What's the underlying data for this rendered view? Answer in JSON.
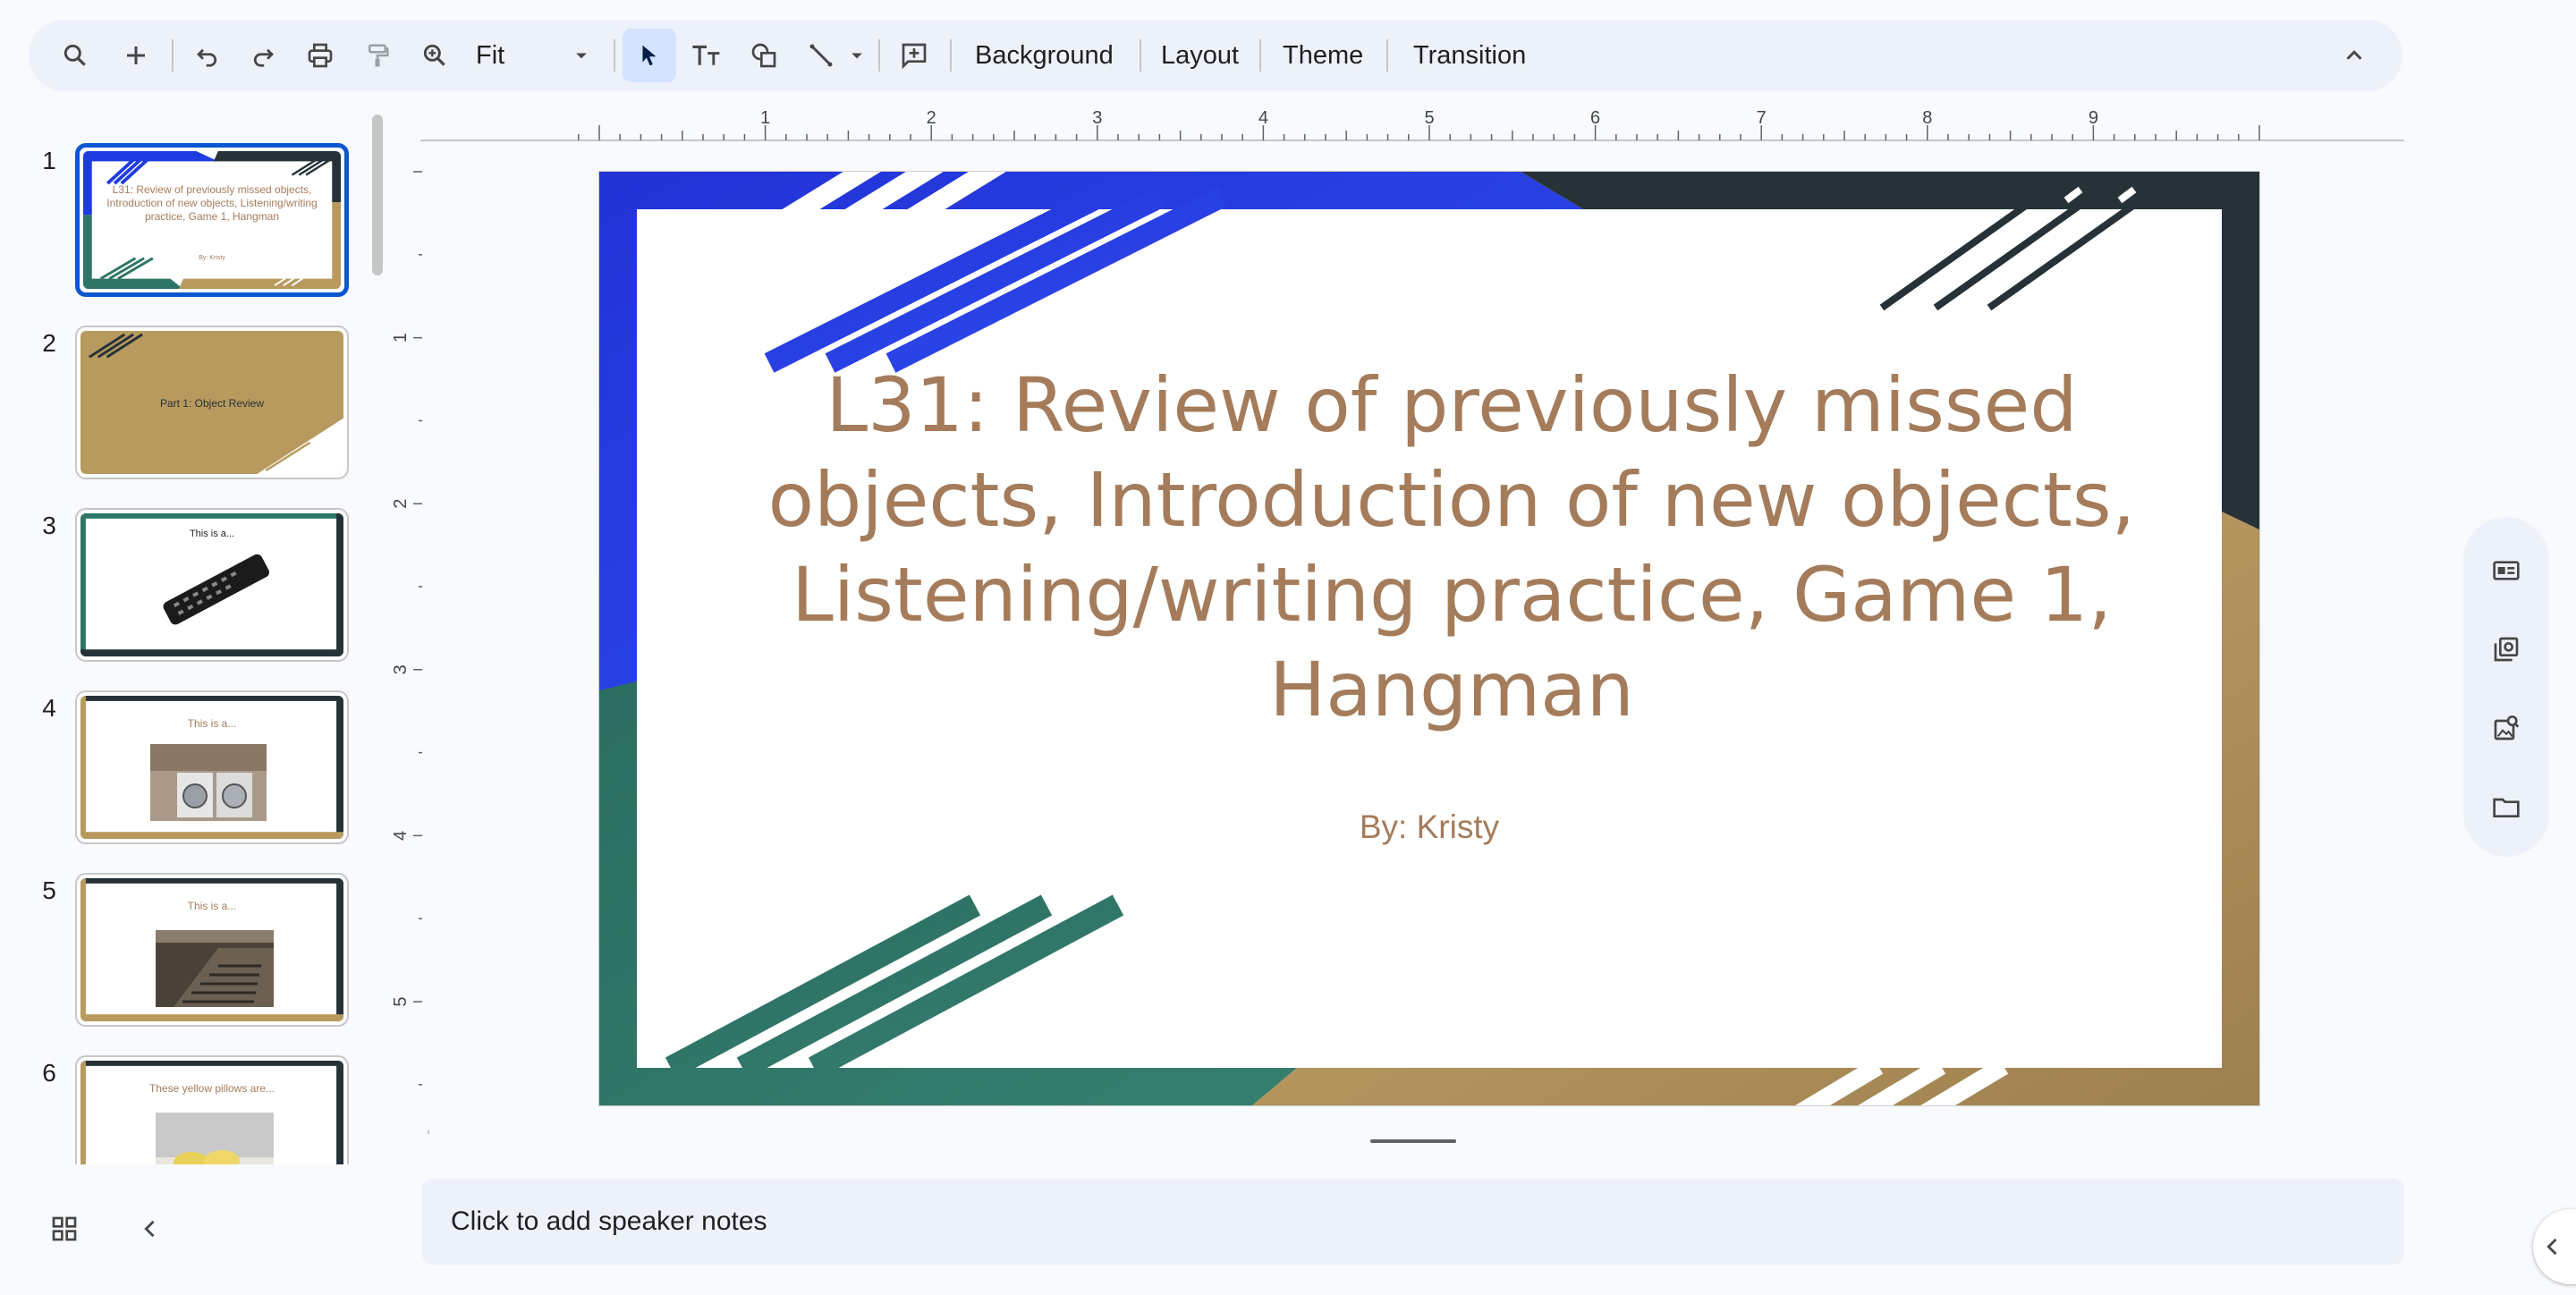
{
  "toolbar": {
    "zoom_value": "Fit",
    "background_label": "Background",
    "layout_label": "Layout",
    "theme_label": "Theme",
    "transition_label": "Transition",
    "icons": [
      "search-icon",
      "plus-icon",
      "undo-icon",
      "redo-icon",
      "print-icon",
      "paint-format-icon",
      "zoom-icon",
      "chevron-down-icon",
      "select-cursor-icon",
      "text-box-icon",
      "shape-icon",
      "line-icon",
      "comment-add-icon",
      "collapse-chevron-up-icon"
    ]
  },
  "ruler": {
    "horizontal_ticks": [
      "1",
      "2",
      "3",
      "4",
      "5",
      "6",
      "7",
      "8",
      "9"
    ],
    "vertical_ticks": [
      "1",
      "2",
      "3",
      "4",
      "5"
    ]
  },
  "slides": [
    {
      "number": "1",
      "title": "L31: Review of previously missed objects, Introduction of new objects, Listening/writing practice, Game 1, Hangman",
      "subtitle": "By: Kristy"
    },
    {
      "number": "2",
      "title": "Part 1: Object Review"
    },
    {
      "number": "3",
      "title": "This is a..."
    },
    {
      "number": "4",
      "title": "This is a..."
    },
    {
      "number": "5",
      "title": "This is a..."
    },
    {
      "number": "6",
      "title": "These yellow pillows are..."
    }
  ],
  "current_slide": {
    "title": "L31: Review of previously missed objects, Introduction of new objects, Listening/writing practice, Game 1, Hangman",
    "subtitle": "By: Kristy"
  },
  "notes": {
    "placeholder": "Click to add speaker notes"
  },
  "side_panel": {
    "icons": [
      "keep-icon",
      "slides-library-icon",
      "image-search-icon",
      "folder-icon"
    ]
  },
  "bottom": {
    "icons": [
      "grid-view-icon",
      "hide-filmstrip-chevron-icon",
      "expand-panel-chevron-icon"
    ]
  },
  "colors": {
    "accent": "#0b57d0",
    "title_text": "#a47c5b",
    "theme_blue": "#1f3ce0",
    "theme_dark": "#263238",
    "theme_green": "#2e7566",
    "theme_gold": "#b89a5e"
  }
}
